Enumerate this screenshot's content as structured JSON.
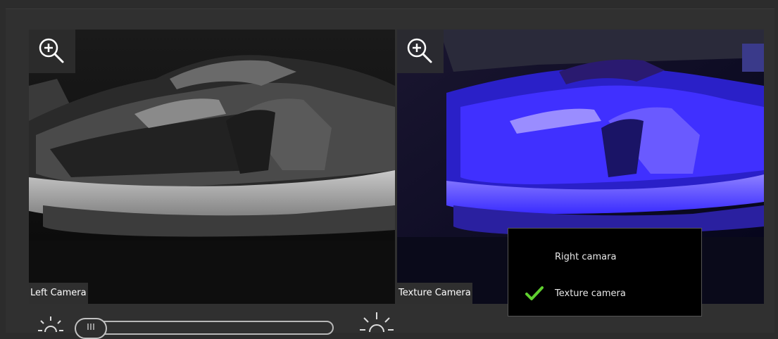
{
  "left_viewer": {
    "label": "Left Camera",
    "zoom_icon": "zoom-in-icon"
  },
  "right_viewer": {
    "label": "Texture Camera",
    "zoom_icon": "zoom-in-icon"
  },
  "camera_menu": {
    "items": [
      {
        "label": "Right camara",
        "checked": false
      },
      {
        "label": "Texture camera",
        "checked": true
      }
    ],
    "check_color": "#5fcf2f"
  },
  "brightness": {
    "low_icon": "sun-low-icon",
    "high_icon": "sun-high-icon",
    "level": 0.0
  },
  "colors": {
    "background": "#2c2c2c",
    "texture_tint": "#3a2cff",
    "label_background": "#2f2f2f"
  }
}
